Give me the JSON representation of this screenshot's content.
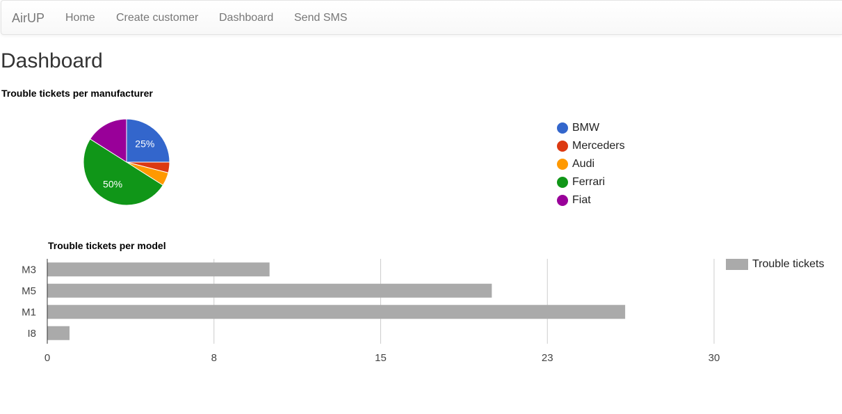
{
  "navbar": {
    "brand": "AirUP",
    "links": [
      {
        "label": "Home"
      },
      {
        "label": "Create customer"
      },
      {
        "label": "Dashboard"
      },
      {
        "label": "Send SMS"
      }
    ]
  },
  "page": {
    "title": "Dashboard"
  },
  "chart_data": [
    {
      "type": "pie",
      "title": "Trouble tickets per manufacturer",
      "slices": [
        {
          "label": "BMW",
          "value": 25,
          "color": "#3366cc"
        },
        {
          "label": "Merceders",
          "value": 4,
          "color": "#dc3912"
        },
        {
          "label": "Audi",
          "value": 5,
          "color": "#ff9900"
        },
        {
          "label": "Ferrari",
          "value": 50,
          "color": "#109618"
        },
        {
          "label": "Fiat",
          "value": 16,
          "color": "#990099"
        }
      ],
      "slice_labels": [
        "25%",
        "50%"
      ],
      "legend_position": "right"
    },
    {
      "type": "bar",
      "orientation": "horizontal",
      "title": "Trouble tickets per model",
      "categories": [
        "M3",
        "M5",
        "M1",
        "I8"
      ],
      "series": [
        {
          "name": "Trouble tickets",
          "values": [
            10,
            20,
            26,
            1
          ],
          "color": "#aaaaaa"
        }
      ],
      "xlim": [
        0,
        30
      ],
      "xticks": [
        "0",
        "8",
        "15",
        "23",
        "30"
      ],
      "grid": true,
      "legend_position": "top-right"
    }
  ]
}
